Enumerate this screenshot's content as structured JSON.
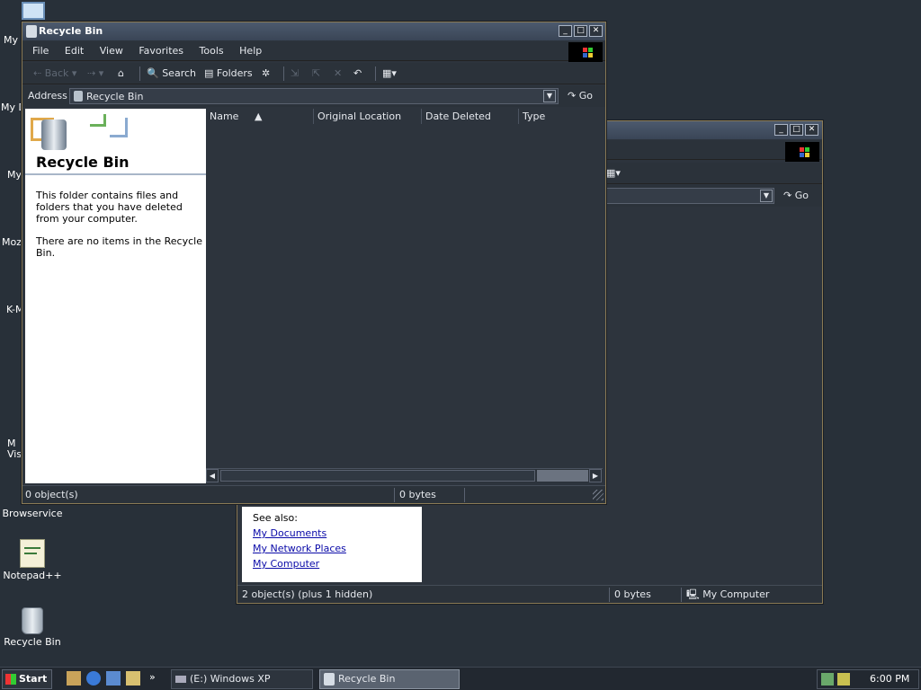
{
  "desktop": {
    "icons": [
      {
        "label": "My",
        "icon": "monitor-icon"
      },
      {
        "label": "My D",
        "icon": "documents-icon"
      },
      {
        "label": "My",
        "icon": "computer-icon"
      },
      {
        "label": "Moz",
        "icon": "mozilla-icon"
      },
      {
        "label": "K-M",
        "icon": "media-icon"
      },
      {
        "label": "M\nVis",
        "icon": "visual-icon"
      },
      {
        "label": "Browservice",
        "icon": "browser-icon"
      },
      {
        "label": "Notepad++",
        "icon": "notepad-icon"
      },
      {
        "label": "Recycle Bin",
        "icon": "recycle-bin-icon"
      }
    ]
  },
  "main_window": {
    "title": "Recycle Bin",
    "menu": [
      "File",
      "Edit",
      "View",
      "Favorites",
      "Tools",
      "Help"
    ],
    "toolbar": {
      "back": "Back",
      "search": "Search",
      "folders": "Folders"
    },
    "address": {
      "label": "Address",
      "value": "Recycle Bin",
      "go": "Go"
    },
    "taskpane": {
      "title": "Recycle Bin",
      "desc": "This folder contains files and folders that you have deleted from your computer.",
      "empty": "There are no items in the Recycle Bin."
    },
    "columns": [
      "Name",
      "Original Location",
      "Date Deleted",
      "Type"
    ],
    "status": {
      "objects": "0 object(s)",
      "size": "0 bytes"
    }
  },
  "back_window": {
    "address_go": "Go",
    "see_also": {
      "heading": "See also:",
      "links": [
        "My Documents",
        "My Network Places",
        "My Computer"
      ]
    },
    "status": {
      "objects": "2 object(s) (plus 1 hidden)",
      "size": "0 bytes",
      "location": "My Computer"
    }
  },
  "taskbar": {
    "start": "Start",
    "tasks": [
      "(E:) Windows XP",
      "Recycle Bin"
    ],
    "clock": "6:00 PM"
  }
}
